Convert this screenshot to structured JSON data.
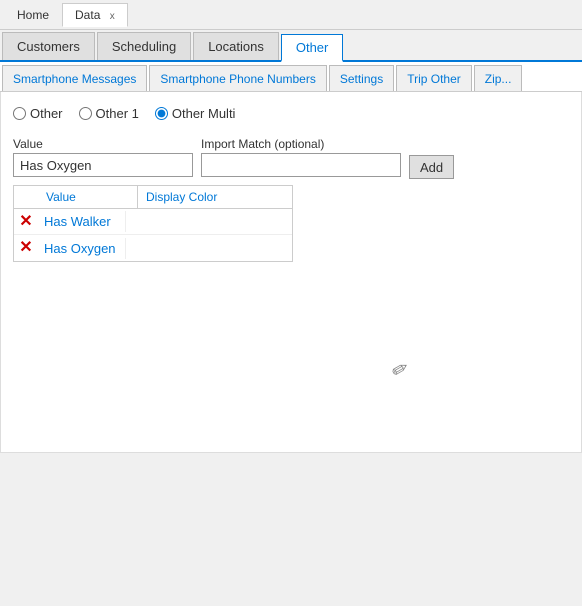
{
  "titleBar": {
    "tabs": [
      {
        "label": "Home",
        "active": false
      },
      {
        "label": "Data",
        "active": true
      },
      {
        "label": "x",
        "isClose": true
      }
    ]
  },
  "navTabs": {
    "tabs": [
      {
        "label": "Customers",
        "active": false
      },
      {
        "label": "Scheduling",
        "active": false
      },
      {
        "label": "Locations",
        "active": false
      },
      {
        "label": "Other",
        "active": true
      }
    ]
  },
  "subTabs": {
    "tabs": [
      {
        "label": "Smartphone Messages",
        "active": false
      },
      {
        "label": "Smartphone Phone Numbers",
        "active": false
      },
      {
        "label": "Settings",
        "active": false
      },
      {
        "label": "Trip Other",
        "active": false
      },
      {
        "label": "Zip...",
        "active": false
      }
    ]
  },
  "radioGroup": {
    "options": [
      {
        "label": "Other",
        "value": "other",
        "checked": false
      },
      {
        "label": "Other 1",
        "value": "other1",
        "checked": false
      },
      {
        "label": "Other Multi",
        "value": "otherMulti",
        "checked": true
      }
    ]
  },
  "form": {
    "valueLabel": "Value",
    "valuePlaceholder": "",
    "valueInput": "Has Oxygen",
    "importMatchLabel": "Import Match (optional)",
    "importMatchInput": "",
    "addButton": "Add"
  },
  "table": {
    "columns": [
      {
        "label": "Value"
      },
      {
        "label": "Display Color"
      }
    ],
    "rows": [
      {
        "value": "Has Walker",
        "color": ""
      },
      {
        "value": "Has Oxygen",
        "color": ""
      }
    ]
  },
  "icons": {
    "delete": "✕",
    "pencil": "✏"
  }
}
